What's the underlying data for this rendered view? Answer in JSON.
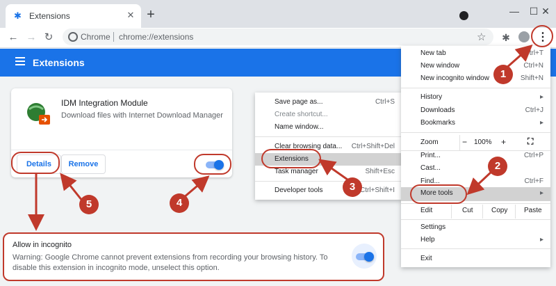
{
  "browser": {
    "tab_title": "Extensions",
    "new_tab_symbol": "+",
    "omnibox_chip": "Chrome",
    "url": "chrome://extensions"
  },
  "header": {
    "title": "Extensions"
  },
  "extension": {
    "name": "IDM Integration Module",
    "description": "Download files with Internet Download Manager",
    "details_label": "Details",
    "remove_label": "Remove",
    "enabled": true
  },
  "incognito": {
    "label": "Allow in incognito",
    "warning": "Warning: Google Chrome cannot prevent extensions from recording your browsing history. To disable this extension in incognito mode, unselect this option.",
    "enabled": true
  },
  "main_menu": {
    "new_tab": {
      "label": "New tab",
      "shortcut": "Ctrl+T"
    },
    "new_window": {
      "label": "New window",
      "shortcut": "Ctrl+N"
    },
    "new_incognito": {
      "label": "New incognito window",
      "shortcut": "Shift+N"
    },
    "history": {
      "label": "History"
    },
    "downloads": {
      "label": "Downloads",
      "shortcut": "Ctrl+J"
    },
    "bookmarks": {
      "label": "Bookmarks"
    },
    "zoom": {
      "label": "Zoom",
      "minus": "−",
      "value": "100%",
      "plus": "+"
    },
    "print": {
      "label": "Print...",
      "shortcut": "Ctrl+P"
    },
    "cast": {
      "label": "Cast..."
    },
    "find": {
      "label": "Find...",
      "shortcut": "Ctrl+F"
    },
    "more_tools": {
      "label": "More tools"
    },
    "edit": {
      "label": "Edit",
      "cut": "Cut",
      "copy": "Copy",
      "paste": "Paste"
    },
    "settings": {
      "label": "Settings"
    },
    "help": {
      "label": "Help"
    },
    "exit": {
      "label": "Exit"
    }
  },
  "submenu": {
    "save_page": {
      "label": "Save page as...",
      "shortcut": "Ctrl+S"
    },
    "create_shortcut": {
      "label": "Create shortcut..."
    },
    "name_window": {
      "label": "Name window..."
    },
    "clear_browsing": {
      "label": "Clear browsing data...",
      "shortcut": "Ctrl+Shift+Del"
    },
    "extensions": {
      "label": "Extensions"
    },
    "task_manager": {
      "label": "Task manager",
      "shortcut": "Shift+Esc"
    },
    "developer_tools": {
      "label": "Developer tools",
      "shortcut": "Ctrl+Shift+I"
    }
  },
  "annotations": {
    "badges": [
      "1",
      "2",
      "3",
      "4",
      "5"
    ],
    "color": "#c0392b"
  },
  "colors": {
    "accent": "#1a73e8",
    "header": "#1a73e8",
    "annotation": "#c0392b"
  },
  "icons": [
    "puzzle-icon",
    "close-icon",
    "back-icon",
    "forward-icon",
    "reload-icon",
    "star-icon",
    "profile-icon",
    "menu-icon",
    "hamburger-icon",
    "fullscreen-icon",
    "chevron-right-icon"
  ]
}
